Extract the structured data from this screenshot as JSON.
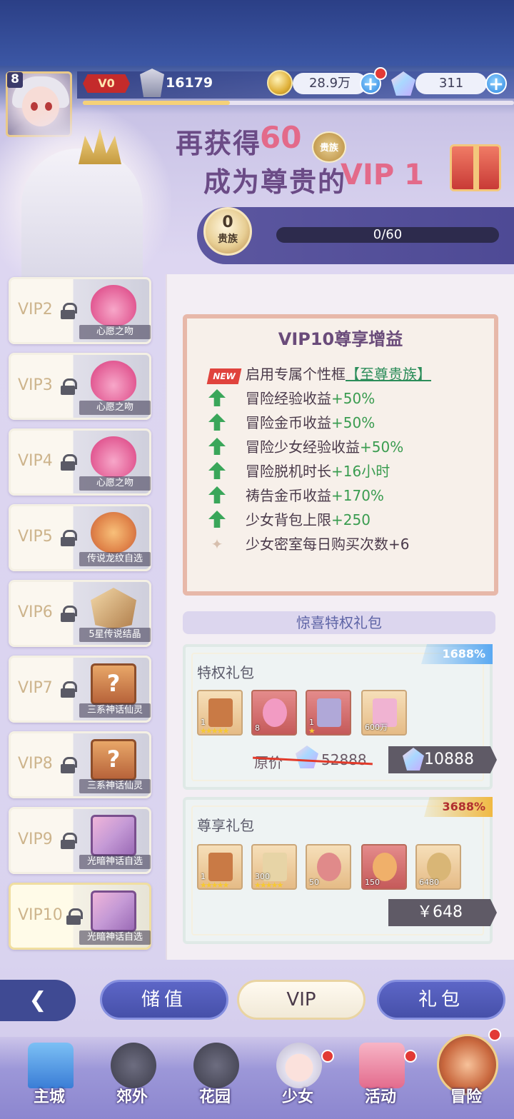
{
  "player": {
    "level": "8",
    "vip": "V0",
    "power": "16179",
    "gold": "28.9万",
    "diamonds": "311"
  },
  "banner": {
    "line1_prefix": "再获得",
    "amount": "60",
    "currency_badge": "贵族",
    "line2": "成为尊贵的",
    "target_vip": "VIP",
    "target_level": "1"
  },
  "progress": {
    "noble_points": "0",
    "noble_label": "贵族",
    "text": "0/60",
    "fraction": 0
  },
  "vip_list": [
    {
      "label": "VIP2",
      "reward": "心愿之吻",
      "icon": "lips-icon"
    },
    {
      "label": "VIP3",
      "reward": "心愿之吻",
      "icon": "lips-icon"
    },
    {
      "label": "VIP4",
      "reward": "心愿之吻",
      "icon": "lips-icon"
    },
    {
      "label": "VIP5",
      "reward": "传说龙纹自选",
      "icon": "dragon-coin-icon"
    },
    {
      "label": "VIP6",
      "reward": "5星传说结晶",
      "icon": "crystal-icon"
    },
    {
      "label": "VIP7",
      "reward": "三系神话仙灵",
      "icon": "mystery-card-icon"
    },
    {
      "label": "VIP8",
      "reward": "三系神话仙灵",
      "icon": "mystery-card-icon"
    },
    {
      "label": "VIP9",
      "reward": "光暗神话自选",
      "icon": "character-card-icon"
    },
    {
      "label": "VIP10",
      "reward": "光暗神话自选",
      "icon": "character-card-icon"
    }
  ],
  "benefits": {
    "title": "VIP10尊享增益",
    "new_tag": "NEW",
    "items": [
      {
        "text": "启用专属个性框",
        "value": "【至尊贵族】"
      },
      {
        "text": "冒险经验收益",
        "value": "+50%"
      },
      {
        "text": "冒险金币收益",
        "value": "+50%"
      },
      {
        "text": "冒险少女经验收益",
        "value": "+50%"
      },
      {
        "text": "冒险脱机时长",
        "value": "+16小时"
      },
      {
        "text": "祷告金币收益",
        "value": "+170%"
      },
      {
        "text": "少女背包上限",
        "value": "+250"
      },
      {
        "text": "少女密室每日购买次数+6",
        "value": ""
      }
    ]
  },
  "surprise_title": "惊喜特权礼包",
  "packs": {
    "privilege": {
      "title": "特权礼包",
      "badge": "1688%",
      "items": [
        {
          "count": "1",
          "stars": "★★★★★",
          "icon": "hero-card-icon"
        },
        {
          "count": "8",
          "stars": "",
          "icon": "lips-icon"
        },
        {
          "count": "1",
          "stars": "★",
          "icon": "dragon-coin-icon"
        },
        {
          "count": "600万",
          "stars": "",
          "icon": "gold-chest-icon"
        }
      ],
      "orig_label": "原价",
      "orig_price": "52888",
      "price": "10888"
    },
    "exclusive": {
      "title": "尊享礼包",
      "badge": "3688%",
      "items": [
        {
          "count": "1",
          "stars": "★★★★★",
          "icon": "hero-card-icon"
        },
        {
          "count": "300",
          "stars": "★★★★★",
          "icon": "treasure-chest-icon"
        },
        {
          "count": "50",
          "stars": "",
          "icon": "ribbon-icon"
        },
        {
          "count": "150",
          "stars": "",
          "icon": "emblem-icon"
        },
        {
          "count": "6480",
          "stars": "",
          "icon": "noble-coin-icon"
        }
      ],
      "price": "￥648"
    }
  },
  "tabs": {
    "recharge": "储值",
    "vip": "VIP",
    "gift": "礼包"
  },
  "nav": [
    {
      "label": "主城",
      "icon": "castle-icon"
    },
    {
      "label": "郊外",
      "icon": "locked-icon"
    },
    {
      "label": "花园",
      "icon": "locked-icon"
    },
    {
      "label": "少女",
      "icon": "girl-icon"
    },
    {
      "label": "活动",
      "icon": "gift-box-icon"
    },
    {
      "label": "冒险",
      "icon": "compass-icon"
    }
  ]
}
